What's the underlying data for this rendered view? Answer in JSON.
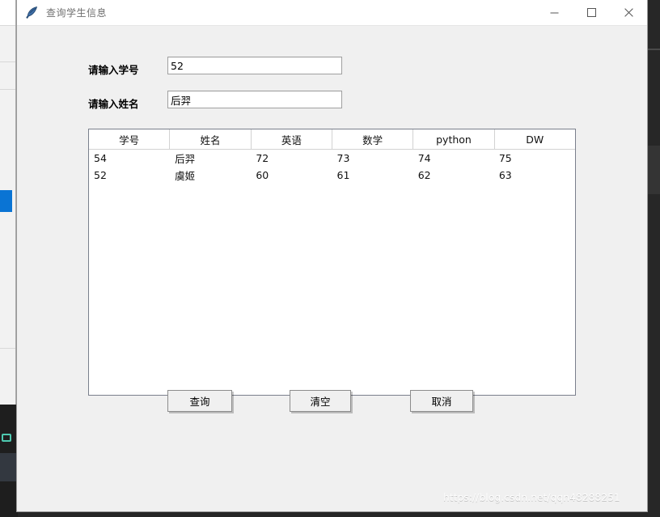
{
  "window": {
    "title": "查询学生信息",
    "icon": "feather-quill-icon",
    "controls": {
      "minimize": "–",
      "maximize": "□",
      "close": "✕"
    }
  },
  "form": {
    "fields": [
      {
        "label": "请输入学号",
        "value": "52",
        "placeholder": "",
        "name": "student-id"
      },
      {
        "label": "请输入姓名",
        "value": "后羿",
        "placeholder": "",
        "name": "student-name"
      }
    ]
  },
  "table": {
    "headers": [
      "学号",
      "姓名",
      "英语",
      "数学",
      "python",
      "DW"
    ],
    "rows": [
      [
        "54",
        "后羿",
        "72",
        "73",
        "74",
        "75"
      ],
      [
        "52",
        "虞姬",
        "60",
        "61",
        "62",
        "63"
      ]
    ]
  },
  "buttons": [
    {
      "label": "查询",
      "name": "query-button"
    },
    {
      "label": "清空",
      "name": "clear-button"
    },
    {
      "label": "取消",
      "name": "cancel-button"
    }
  ],
  "watermark": {
    "text": "https://blog.csdn.net/qqn48288251"
  },
  "colors": {
    "window_background": "#f0f0f0",
    "titlebar": "#ffffff",
    "entry_background": "#ffffff",
    "entry_border": "#a0a0a0",
    "table_border": "#7a7f8c",
    "selection_blue": "#0a74d4",
    "desktop_dark": "#262626"
  }
}
